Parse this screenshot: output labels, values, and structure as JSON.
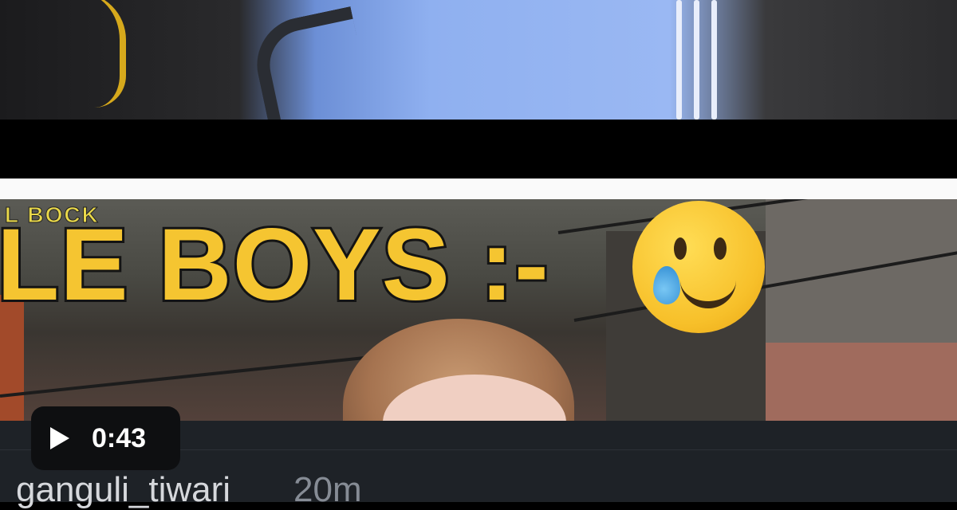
{
  "video_frame": {
    "caption_text": "LE BOYS :-",
    "overlay_text": "L BOCK",
    "emoji": "face-holding-back-tears"
  },
  "player": {
    "duration": "0:43",
    "play_icon": "play-icon"
  },
  "post": {
    "username": "ganguli_tiwari",
    "age": "20m"
  },
  "colors": {
    "caption": "#f5c531",
    "footer_bg": "#1e2227",
    "pill_bg": "#0e0f11"
  }
}
